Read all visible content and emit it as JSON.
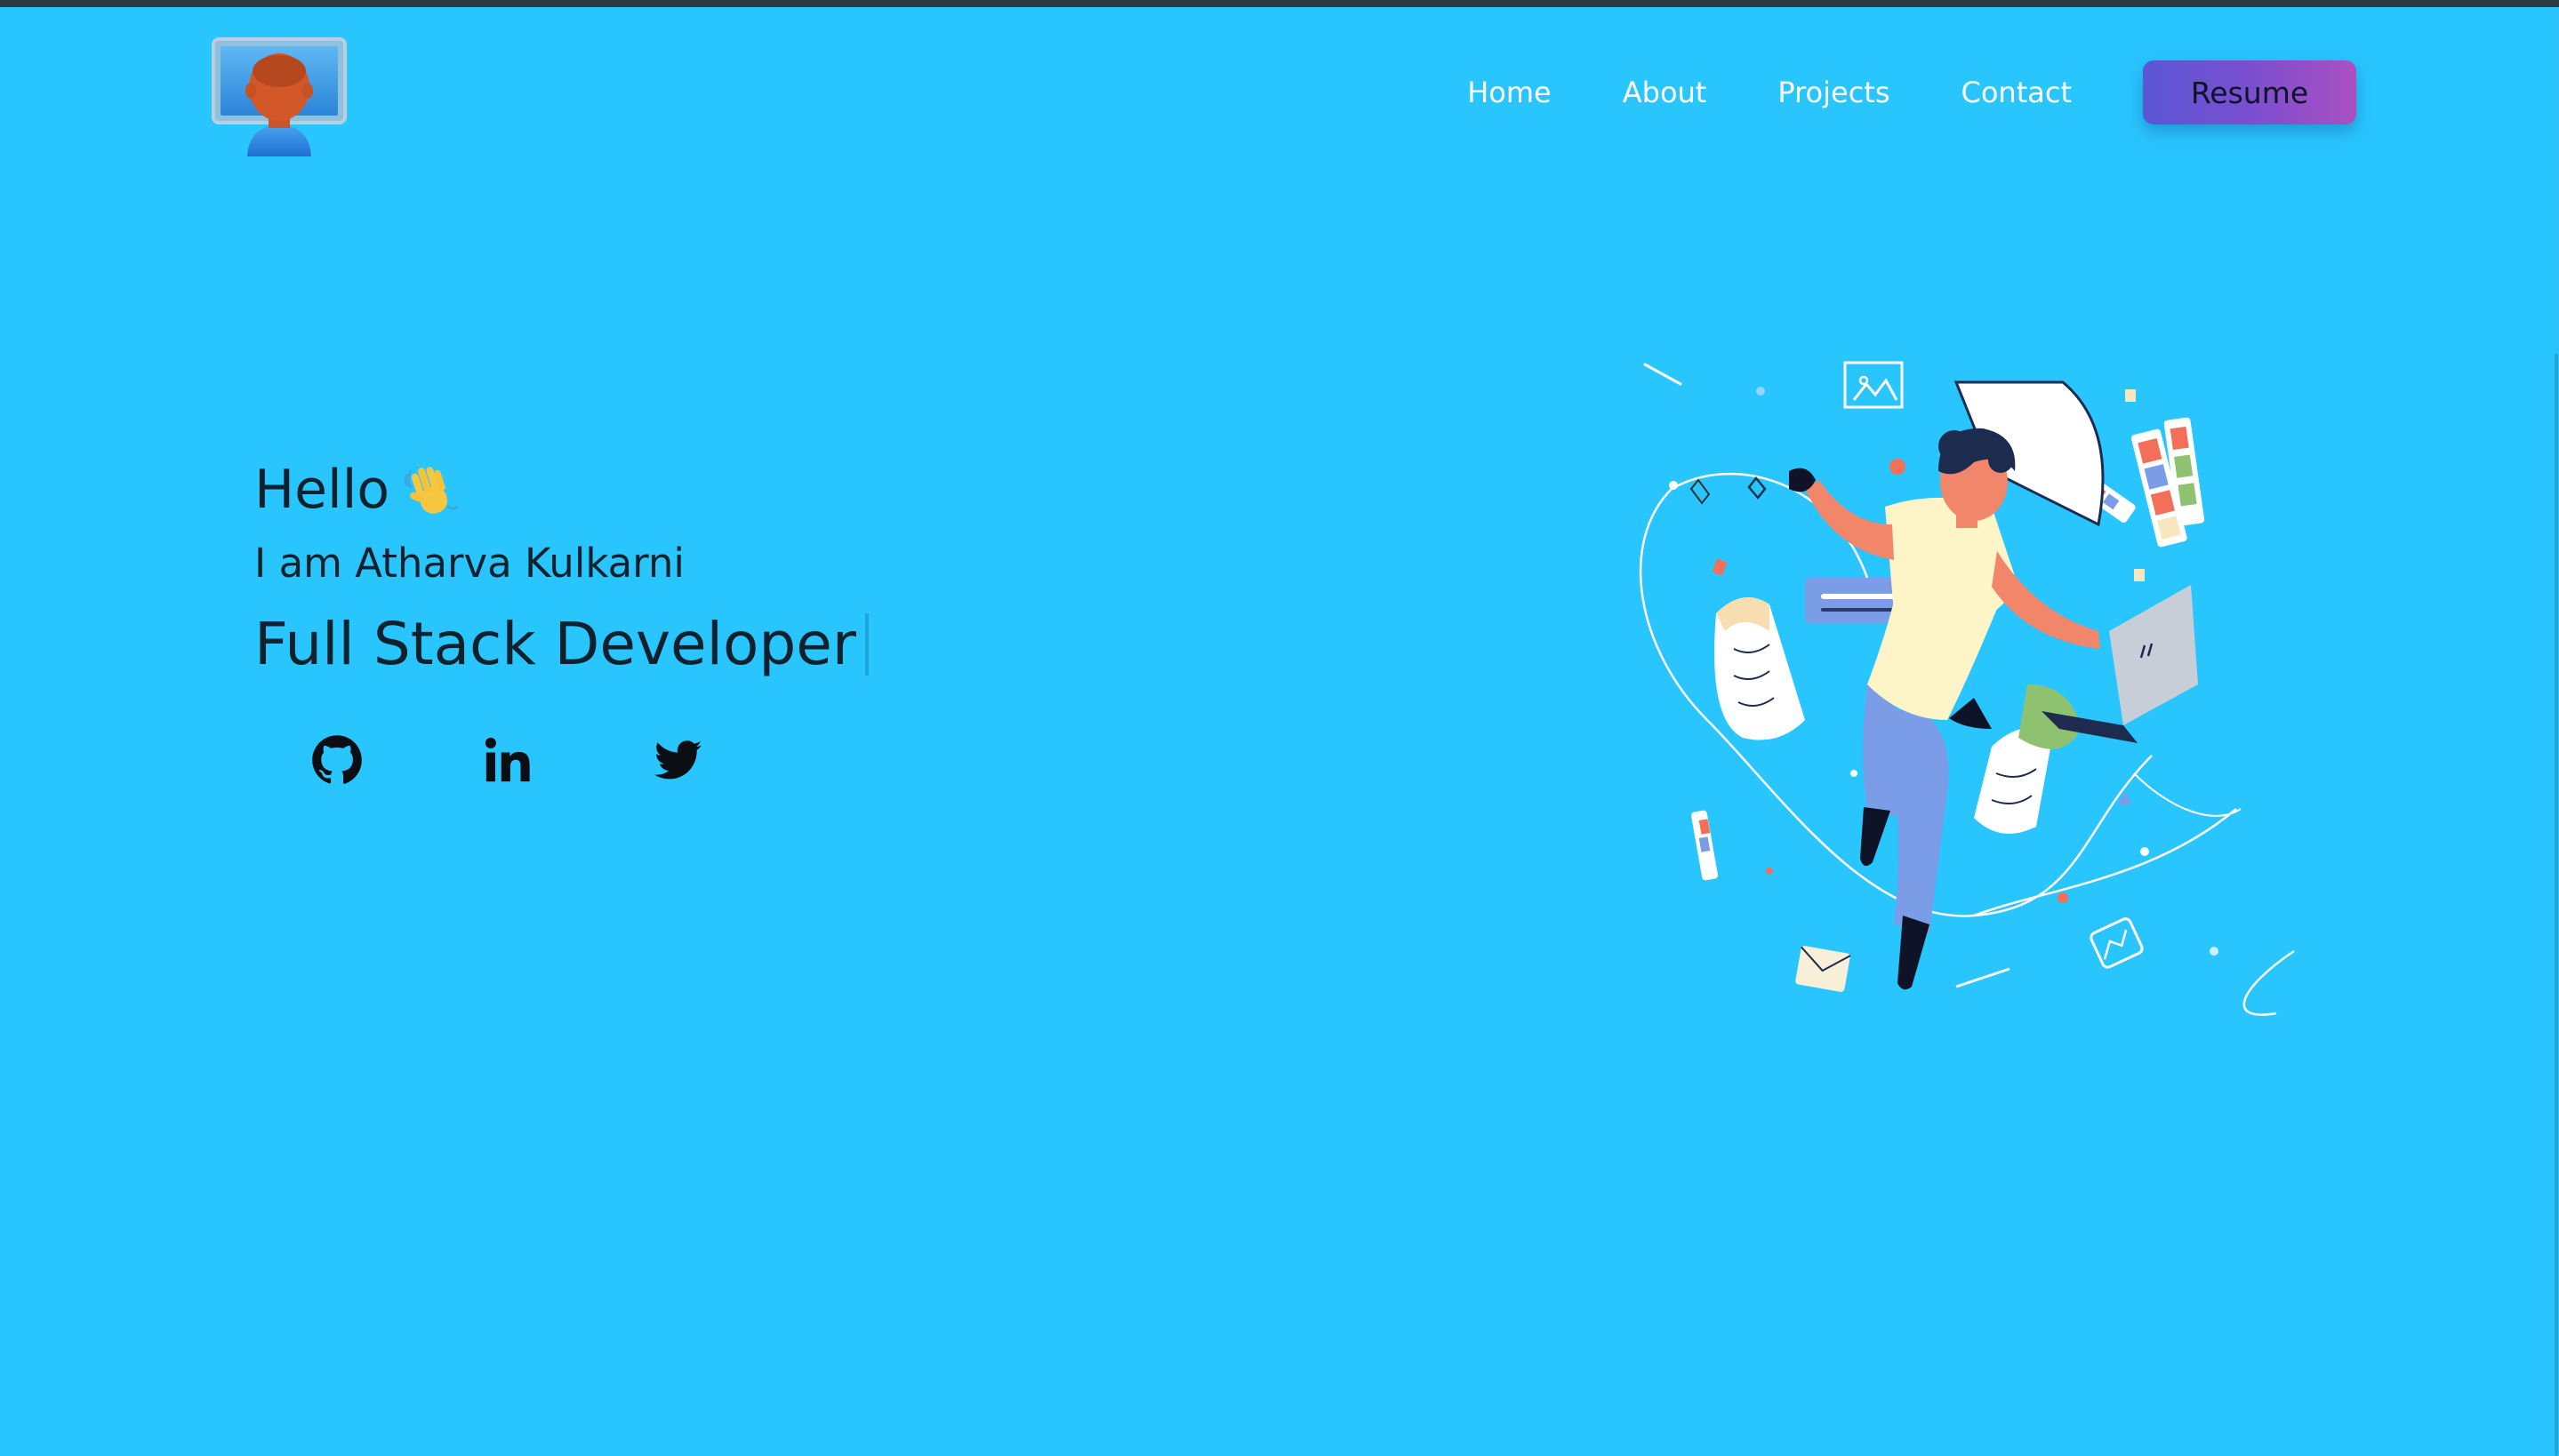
{
  "nav": {
    "links": [
      "Home",
      "About",
      "Projects",
      "Contact"
    ],
    "resume_label": "Resume"
  },
  "hero": {
    "greeting": "Hello",
    "wave_emoji": "👋",
    "intro": "I am Atharva Kulkarni",
    "role": "Full Stack Developer"
  },
  "socials": [
    {
      "icon": "github-icon"
    },
    {
      "icon": "linkedin-icon"
    },
    {
      "icon": "twitter-icon"
    }
  ],
  "colors": {
    "background": "#29c5ff",
    "text": "#10212e",
    "nav_text": "#ffffff",
    "button_gradient_start": "#5957d5",
    "button_gradient_end": "#ab4fc2"
  }
}
